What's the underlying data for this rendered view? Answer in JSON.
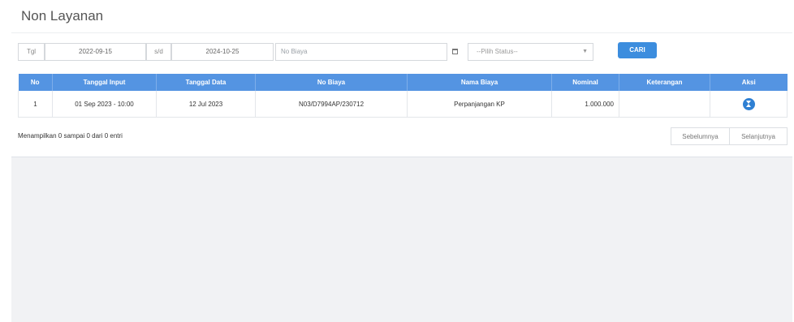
{
  "page": {
    "title": "Non Layanan"
  },
  "filter": {
    "tgl_label": "Tgl",
    "date_from": "2022-09-15",
    "sd_label": "s/d",
    "date_to": "2024-10-25",
    "no_biaya_placeholder": "No Biaya",
    "calendar_icon": "calendar-icon",
    "status_placeholder": "--Pilih Status--",
    "search_button": "CARI"
  },
  "table": {
    "headers": [
      "No",
      "Tanggal Input",
      "Tanggal Data",
      "No Biaya",
      "Nama Biaya",
      "Nominal",
      "Keterangan",
      "Aksi"
    ],
    "rows": [
      {
        "no": "1",
        "tanggal_input": "01 Sep 2023 - 10:00",
        "tanggal_data": "12 Jul 2023",
        "no_biaya": "N03/D7994AP/230712",
        "nama_biaya": "Perpanjangan KP",
        "nominal": "1.000.000",
        "keterangan": "",
        "aksi_icon": "hourglass-icon"
      }
    ]
  },
  "footer": {
    "info": "Menampilkan 0 sampai 0 dari 0 entri",
    "prev": "Sebelumnya",
    "next": "Selanjutnya"
  },
  "colors": {
    "header_bg": "#5494e2",
    "button_bg": "#3c8dde",
    "action_bg": "#2f80d3"
  }
}
